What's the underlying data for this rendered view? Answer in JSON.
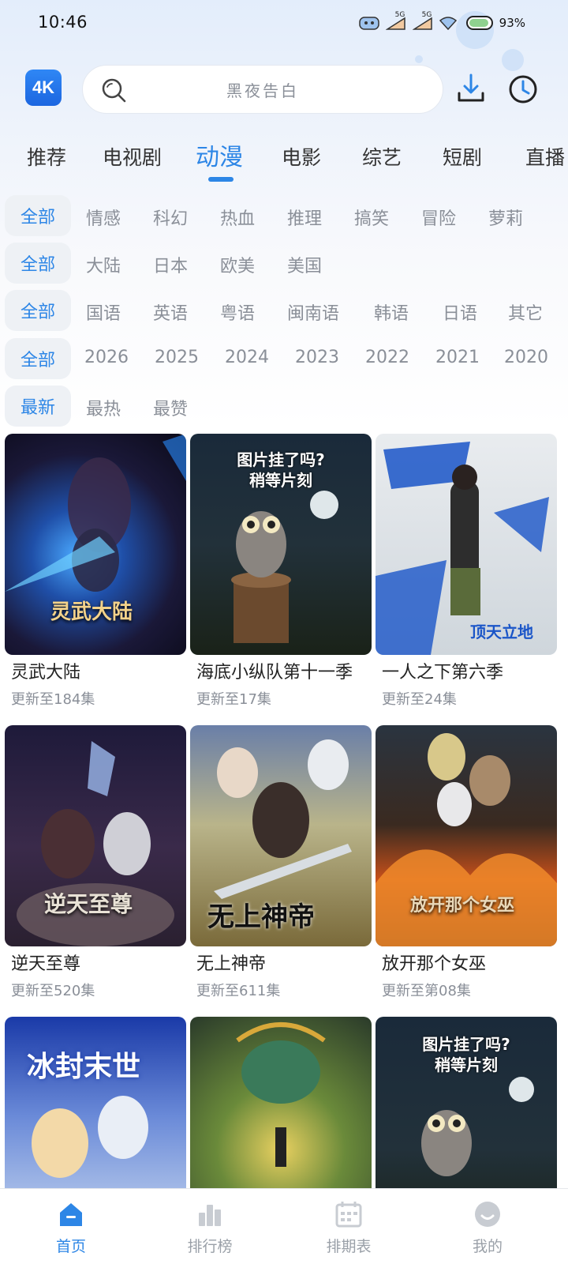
{
  "status_bar": {
    "time": "10:46",
    "signal_1": "5G",
    "signal_2": "5G",
    "battery": "93%"
  },
  "header": {
    "logo": "4K",
    "search_placeholder": "黑夜告白",
    "icons": [
      "search-icon",
      "download-icon",
      "history-icon"
    ]
  },
  "category_tabs": {
    "items": [
      "推荐",
      "电视剧",
      "动漫",
      "电影",
      "综艺",
      "短剧",
      "直播"
    ],
    "active": "动漫"
  },
  "filters": {
    "genre": {
      "selected": "全部",
      "options": [
        "情感",
        "科幻",
        "热血",
        "推理",
        "搞笑",
        "冒险",
        "萝莉"
      ]
    },
    "region": {
      "selected": "全部",
      "options": [
        "大陆",
        "日本",
        "欧美",
        "美国"
      ]
    },
    "language": {
      "selected": "全部",
      "options": [
        "国语",
        "英语",
        "粤语",
        "闽南语",
        "韩语",
        "日语",
        "其它"
      ]
    },
    "year": {
      "selected": "全部",
      "options": [
        "2026",
        "2025",
        "2024",
        "2023",
        "2022",
        "2021",
        "2020"
      ]
    },
    "sort": {
      "selected": "最新",
      "options": [
        "最热",
        "最赞"
      ]
    }
  },
  "videos": [
    {
      "title": "灵武大陆",
      "update": "更新至184集",
      "poster_text": "灵武大陆"
    },
    {
      "title": "海底小纵队第十一季",
      "update": "更新至17集",
      "poster_text": "图片挂了吗?\n稍等片刻"
    },
    {
      "title": "一人之下第六季",
      "update": "更新至24集",
      "poster_text": "顶天立地"
    },
    {
      "title": "逆天至尊",
      "update": "更新至520集",
      "poster_text": "逆天至尊"
    },
    {
      "title": "无上神帝",
      "update": "更新至611集",
      "poster_text": "无上神帝"
    },
    {
      "title": "放开那个女巫",
      "update": "更新至第08集",
      "poster_text": "放开那个女巫"
    },
    {
      "title": "",
      "update": "",
      "poster_text": "冰封末世"
    },
    {
      "title": "",
      "update": "",
      "poster_text": ""
    },
    {
      "title": "",
      "update": "",
      "poster_text": "图片挂了吗?\n稍等片刻"
    }
  ],
  "bottom_nav": {
    "items": [
      {
        "label": "首页",
        "icon": "home-icon",
        "active": true
      },
      {
        "label": "排行榜",
        "icon": "ranking-icon",
        "active": false
      },
      {
        "label": "排期表",
        "icon": "calendar-icon",
        "active": false
      },
      {
        "label": "我的",
        "icon": "profile-icon",
        "active": false
      }
    ]
  },
  "colors": {
    "accent": "#2d86e6",
    "muted_text": "#8a8f98",
    "pill_bg": "#eef1f5"
  }
}
